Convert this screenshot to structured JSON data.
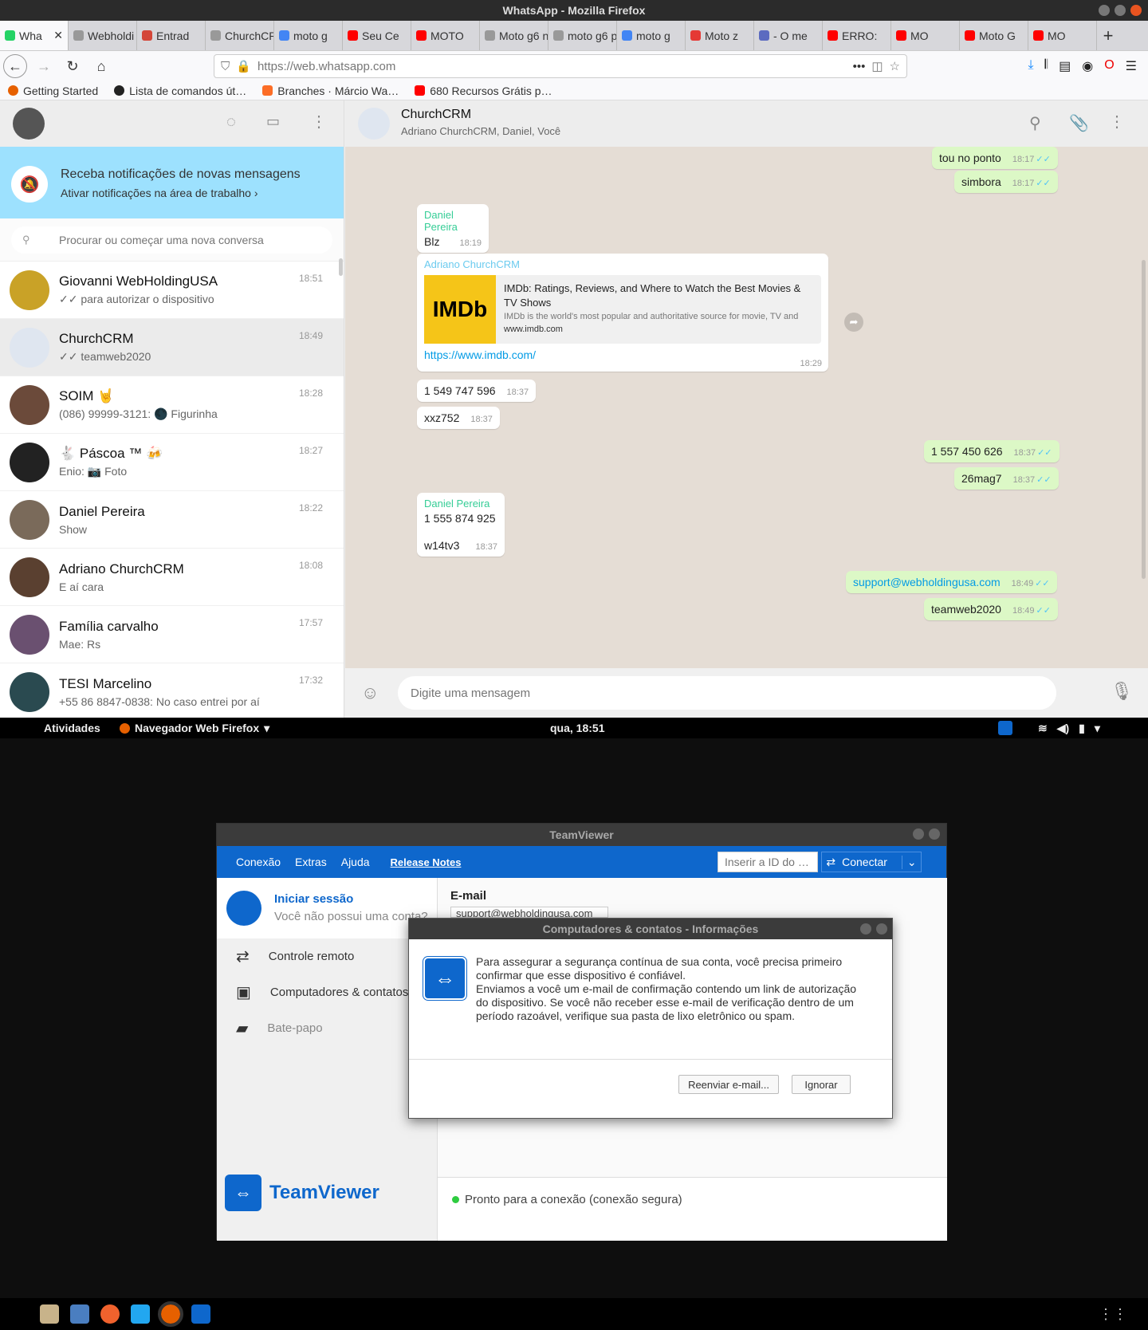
{
  "window_title": "WhatsApp - Mozilla Firefox",
  "tabs": [
    {
      "label": "Wha",
      "color": "#25d366"
    },
    {
      "label": "Webholdi",
      "color": "#999"
    },
    {
      "label": "Entrad",
      "color": "#d44638"
    },
    {
      "label": "ChurchCR",
      "color": "#999"
    },
    {
      "label": "moto g",
      "color": "#4285f4"
    },
    {
      "label": "Seu Ce",
      "color": "#ff0000"
    },
    {
      "label": "MOTO",
      "color": "#ff0000"
    },
    {
      "label": "Moto g6 n",
      "color": "#999"
    },
    {
      "label": "moto g6 p",
      "color": "#999"
    },
    {
      "label": "moto g",
      "color": "#4285f4"
    },
    {
      "label": "Moto z",
      "color": "#e53935"
    },
    {
      "label": "- O me",
      "color": "#5c6bc0"
    },
    {
      "label": "ERRO:",
      "color": "#ff0000"
    },
    {
      "label": "MO",
      "color": "#ff0000"
    },
    {
      "label": "Moto G",
      "color": "#ff0000"
    },
    {
      "label": "MO",
      "color": "#ff0000"
    }
  ],
  "url": "https://web.whatsapp.com",
  "bookmarks": [
    "Getting Started",
    "Lista de comandos út…",
    "Branches · Márcio Wa…",
    "680 Recursos Grátis p…"
  ],
  "notification": {
    "title": "Receba notificações de novas mensagens",
    "subtitle": "Ativar notificações na área de trabalho ›"
  },
  "search_placeholder": "Procurar ou começar uma nova conversa",
  "chats": [
    {
      "name": "Giovanni WebHoldingUSA",
      "msg": "✓✓ para autorizar o dispositivo",
      "time": "18:51",
      "color": "#c9a227"
    },
    {
      "name": "ChurchCRM",
      "msg": "✓✓ teamweb2020",
      "time": "18:49",
      "color": "#dfe6f0"
    },
    {
      "name": "SOIM 🤘",
      "msg": "(086) 99999-3121: 🌑 Figurinha",
      "time": "18:28",
      "color": "#6b4a3a"
    },
    {
      "name": "🐇 Páscoa ™ 🍻",
      "msg": "Enio: 📷 Foto",
      "time": "18:27",
      "color": "#222"
    },
    {
      "name": "Daniel Pereira",
      "msg": "Show",
      "time": "18:22",
      "color": "#7a6a5a"
    },
    {
      "name": "Adriano ChurchCRM",
      "msg": "E aí cara",
      "time": "18:08",
      "color": "#5a4030"
    },
    {
      "name": "Família carvalho",
      "msg": "Mae: Rs",
      "time": "17:57",
      "color": "#6a5070"
    },
    {
      "name": "TESI Marcelino",
      "msg": "+55 86 8847-0838: No caso entrei por aí",
      "time": "17:32",
      "color": "#2a4a50"
    }
  ],
  "conversation": {
    "name": "ChurchCRM",
    "members": "Adriano ChurchCRM, Daniel, Você"
  },
  "messages": {
    "m1": {
      "text": "tou no ponto",
      "time": "18:17"
    },
    "m2": {
      "text": "simbora",
      "time": "18:17"
    },
    "m3": {
      "author": "Daniel Pereira",
      "text": "Blz",
      "time": "18:19"
    },
    "m4": {
      "author": "Adriano ChurchCRM",
      "preview_title": "IMDb: Ratings, Reviews, and Where to Watch the Best Movies & TV Shows",
      "preview_desc": "IMDb is the world's most popular and authoritative source for movie, TV and",
      "preview_domain": "www.imdb.com",
      "logo": "IMDb",
      "link": "https://www.imdb.com/",
      "time": "18:29"
    },
    "m5": {
      "text": "1 549 747 596",
      "time": "18:37"
    },
    "m6": {
      "text": "xxz752",
      "time": "18:37"
    },
    "m7": {
      "text": "1 557 450 626",
      "time": "18:37"
    },
    "m8": {
      "text": "26mag7",
      "time": "18:37"
    },
    "m9": {
      "author": "Daniel Pereira",
      "text": "1 555 874 925",
      "text2": "w14tv3",
      "time": "18:37"
    },
    "m10": {
      "text": "support@webholdingusa.com",
      "time": "18:49"
    },
    "m11": {
      "text": "teamweb2020",
      "time": "18:49"
    }
  },
  "composer_placeholder": "Digite uma mensagem",
  "gnome": {
    "activities": "Atividades",
    "app": "Navegador Web Firefox",
    "clock": "qua, 18:51"
  },
  "teamviewer": {
    "title": "TeamViewer",
    "menu": [
      "Conexão",
      "Extras",
      "Ajuda",
      "Release Notes"
    ],
    "id_placeholder": "Inserir a ID do …",
    "connect": "Conectar",
    "signin": "Iniciar sessão",
    "no_account": "Você não possui uma conta?",
    "nav": [
      "Controle remoto",
      "Computadores & contatos",
      "Bate-papo"
    ],
    "email_label": "E-mail",
    "email_value": "support@webholdingusa.com",
    "status": "Pronto para a conexão (conexão segura)",
    "brand": "TeamViewer"
  },
  "dialog": {
    "title": "Computadores & contatos - Informações",
    "body": "Para assegurar a segurança contínua de sua conta, você precisa primeiro confirmar que esse dispositivo é confiável.\nEnviamos a você um e-mail de confirmação contendo um link de autorização do dispositivo. Se você não receber esse e-mail de verificação dentro de um período razoável, verifique sua pasta de lixo eletrônico ou spam.",
    "resend": "Reenviar e-mail...",
    "ignore": "Ignorar"
  }
}
